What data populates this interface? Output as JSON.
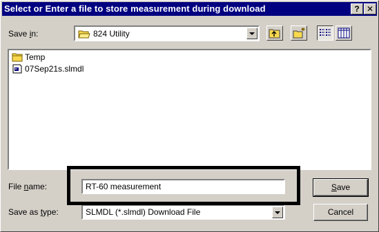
{
  "window": {
    "title": "Select or Enter a file to store measurement during download",
    "help_glyph": "?",
    "close_glyph": "✕"
  },
  "save_in": {
    "label_pre": "Save ",
    "label_key": "i",
    "label_post": "n:",
    "value": "824 Utility"
  },
  "files": [
    {
      "name": "Temp",
      "icon": "folder-icon"
    },
    {
      "name": "07Sep21s.slmdl",
      "icon": "document-icon"
    }
  ],
  "file_name": {
    "label_pre": "File ",
    "label_key": "n",
    "label_post": "ame:",
    "value": "RT-60 measurement"
  },
  "save_type": {
    "label_pre": "Save as ",
    "label_key": "t",
    "label_post": "ype:",
    "value": "SLMDL (*.slmdl) Download File"
  },
  "buttons": {
    "save_key": "S",
    "save_rest": "ave",
    "cancel": "Cancel"
  }
}
